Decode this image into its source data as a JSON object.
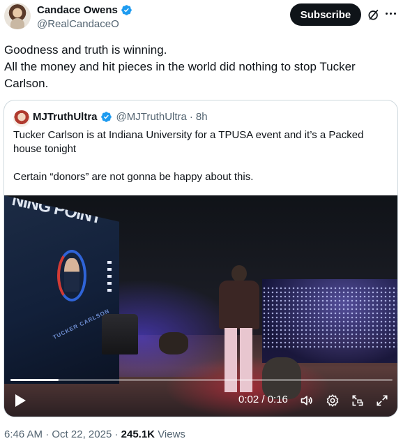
{
  "author": {
    "display_name": "Candace Owens",
    "handle": "@RealCandaceO"
  },
  "actions": {
    "subscribe_label": "Subscribe",
    "grok_icon": "grok-icon",
    "more_icon": "more-icon"
  },
  "post": {
    "lines": [
      "Goodness and truth is winning.",
      "All the money and hit pieces in the world did nothing to stop Tucker",
      "Carlson."
    ]
  },
  "quoted": {
    "display_name": "MJTruthUltra",
    "handle": "@MJTruthUltra",
    "separator": "·",
    "time_ago": "8h",
    "lines": [
      "Tucker Carlson is at Indiana University for a TPUSA event and it’s a Packed",
      "house tonight",
      "",
      "Certain “donors” are not gonna be happy about this."
    ],
    "video": {
      "current_time": "0:02",
      "duration": "0:16",
      "time_display": "0:02 / 0:16",
      "progress_fraction": 0.125,
      "screen_text_a": "NING POINT",
      "screen_text_b": "TUCKER CARLSON"
    }
  },
  "meta": {
    "time": "6:46 AM",
    "separator": "·",
    "date": "Oct 22, 2025",
    "views_count": "245.1K",
    "views_label": "Views"
  },
  "colors": {
    "text": "#0f1419",
    "secondary": "#536471",
    "verified_blue": "#1d9bf0",
    "border": "#cfd9de"
  }
}
